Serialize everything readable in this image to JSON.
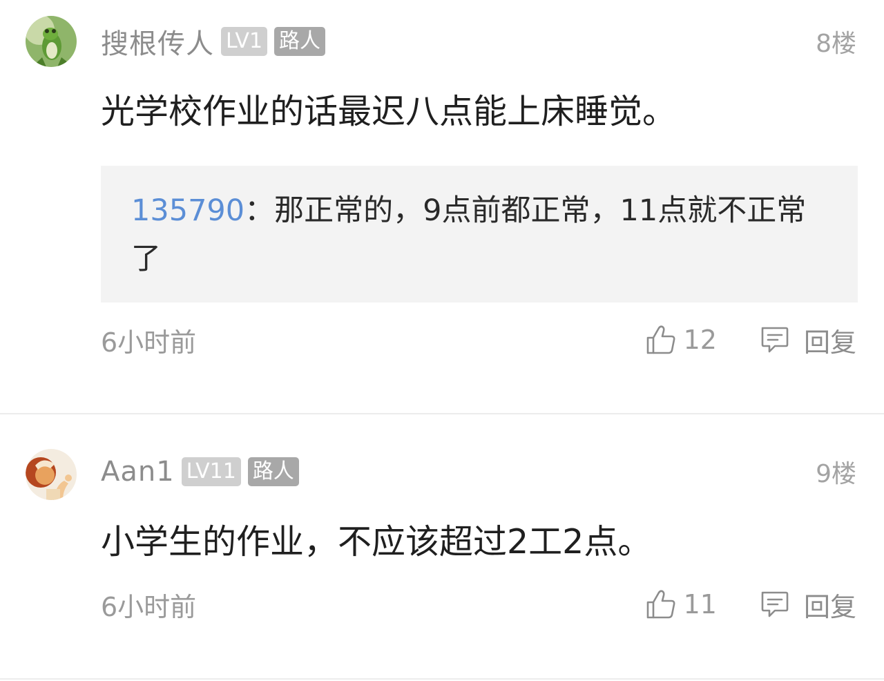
{
  "comments": [
    {
      "username": "搜根传人",
      "level": "LV1",
      "role": "路人",
      "floor": "8楼",
      "text": "光学校作业的话最迟八点能上床睡觉。",
      "quote": {
        "author": "135790",
        "separator": "：",
        "text": "那正常的，9点前都正常，11点就不正常了"
      },
      "time": "6小时前",
      "likes": "12",
      "reply_label": "回复",
      "avatar_icon": "frog-avatar"
    },
    {
      "username": "Aan1",
      "level": "LV11",
      "role": "路人",
      "floor": "9楼",
      "text": "小学生的作业，不应该超过2工2点。",
      "time": "6小时前",
      "likes": "11",
      "reply_label": "回复",
      "avatar_icon": "person-avatar"
    }
  ],
  "colors": {
    "link": "#5b8ed6",
    "muted": "#9a9a9a",
    "quote_bg": "#f3f3f3",
    "badge_level": "#cfcfcf",
    "badge_role": "#a8a8a8"
  }
}
